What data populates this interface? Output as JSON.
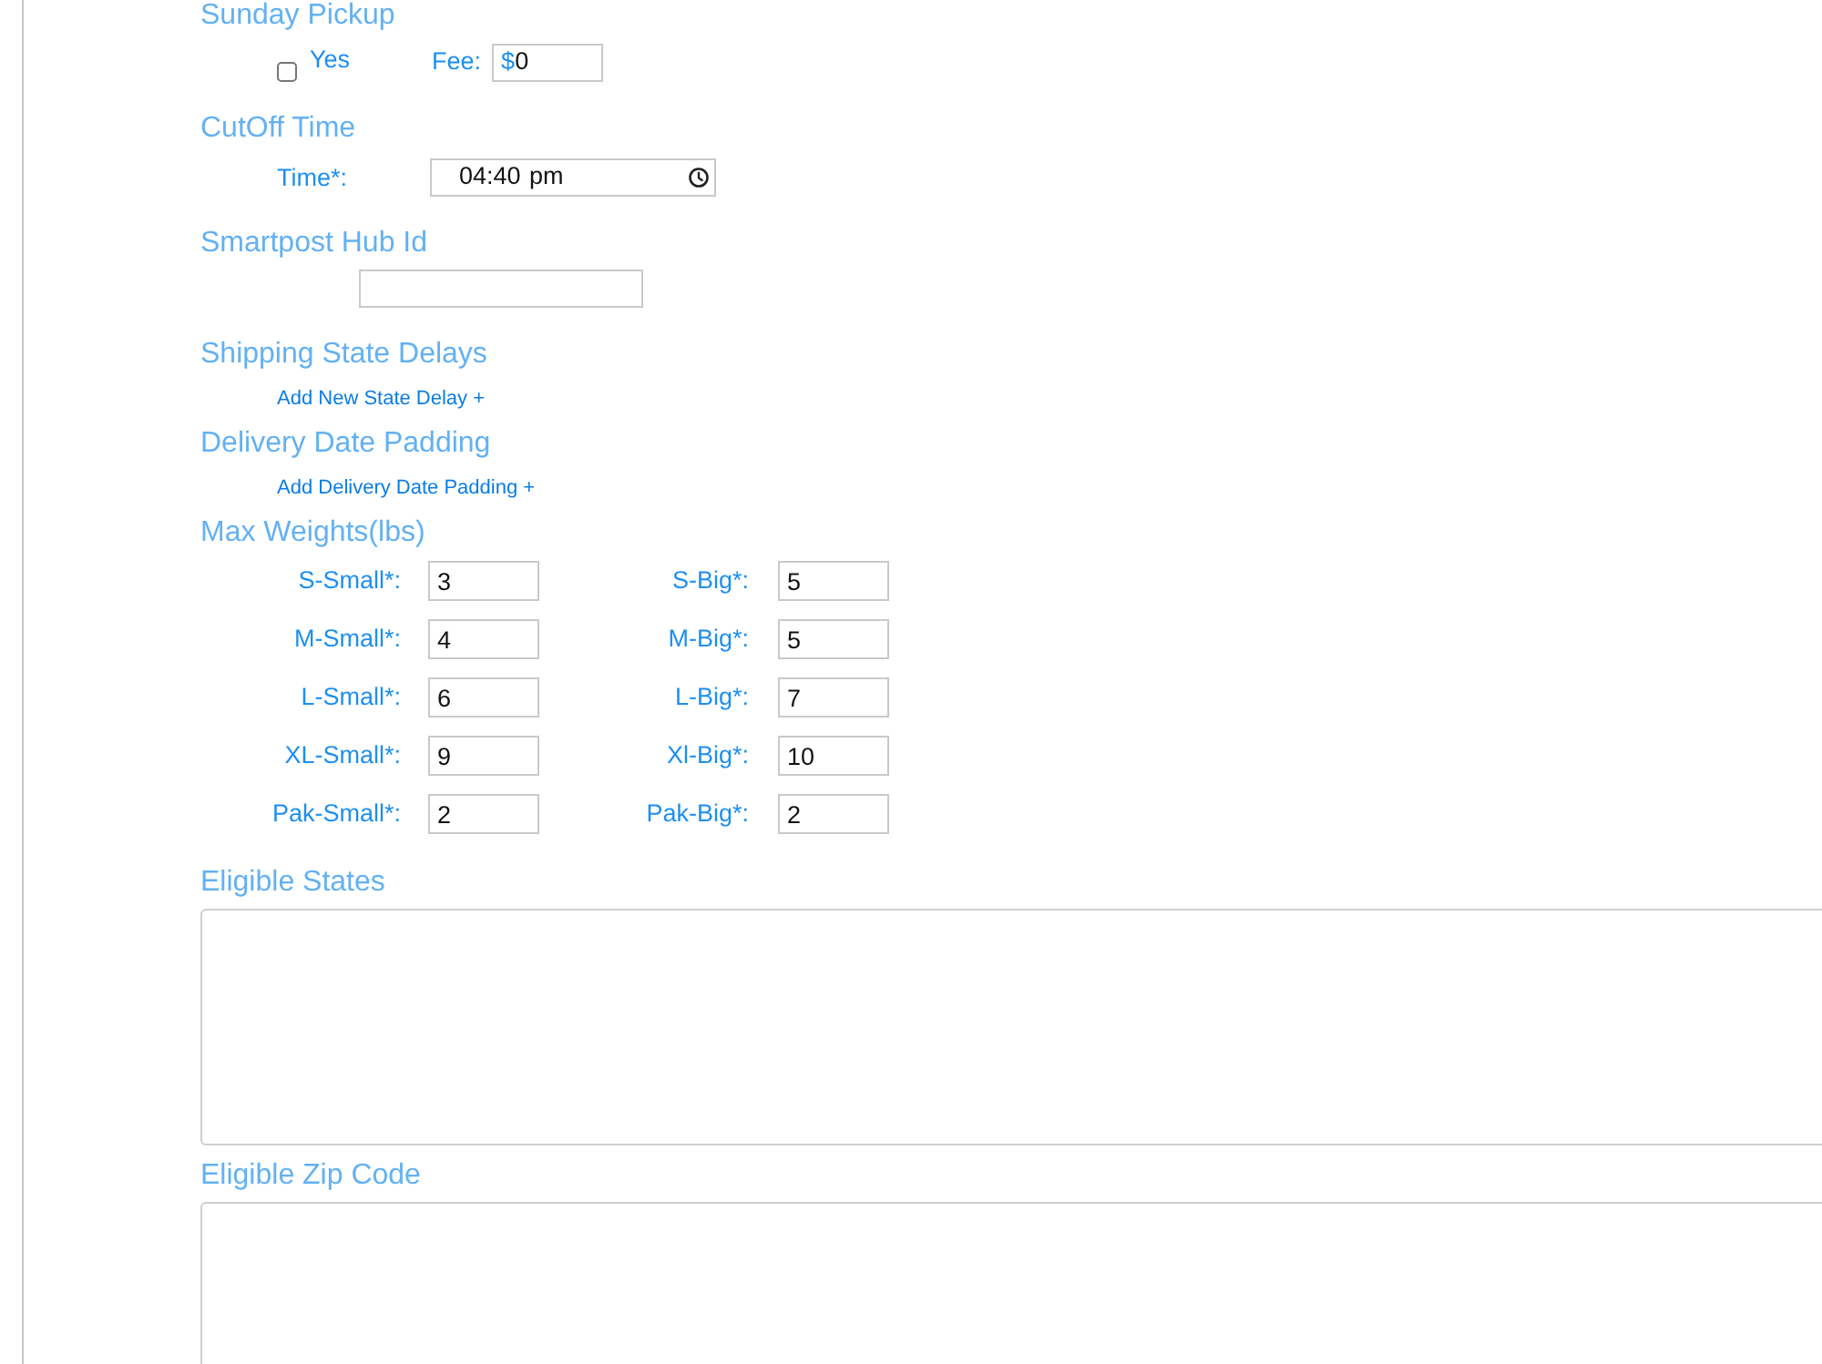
{
  "sections": [
    {
      "kind": "pickup",
      "title": "Sunday Pickup",
      "checkbox": {
        "label": "Yes",
        "checked": false
      },
      "fee": {
        "label": "Fee:",
        "currency": "$",
        "value": "0"
      }
    },
    {
      "kind": "time",
      "title": "CutOff Time",
      "label": "Time*:",
      "value": "04:40 pm"
    },
    {
      "kind": "input",
      "title": "Smartpost Hub Id"
    },
    {
      "kind": "link",
      "title": "Shipping State Delays",
      "link": "Add New State Delay +"
    },
    {
      "kind": "link",
      "title": "Delivery Date Padding",
      "link": "Add Delivery Date Padding +"
    },
    {
      "kind": "weights",
      "title": "Max Weights(lbs)",
      "rows": [
        [
          {
            "label": "S-Small*:",
            "value": "3"
          },
          {
            "label": "S-Big*:",
            "value": "5"
          }
        ],
        [
          {
            "label": "M-Small*:",
            "value": "4"
          },
          {
            "label": "M-Big*:",
            "value": "5"
          }
        ],
        [
          {
            "label": "L-Small*:",
            "value": "6"
          },
          {
            "label": "L-Big*:",
            "value": "7"
          }
        ],
        [
          {
            "label": "XL-Small*:",
            "value": "9"
          },
          {
            "label": "Xl-Big*:",
            "value": "10"
          }
        ],
        [
          {
            "label": "Pak-Small*:",
            "value": "2"
          },
          {
            "label": "Pak-Big*:",
            "value": "2"
          }
        ]
      ]
    },
    {
      "kind": "textarea",
      "title": "Eligible States"
    },
    {
      "kind": "textarea",
      "title": "Eligible Zip Code"
    }
  ]
}
